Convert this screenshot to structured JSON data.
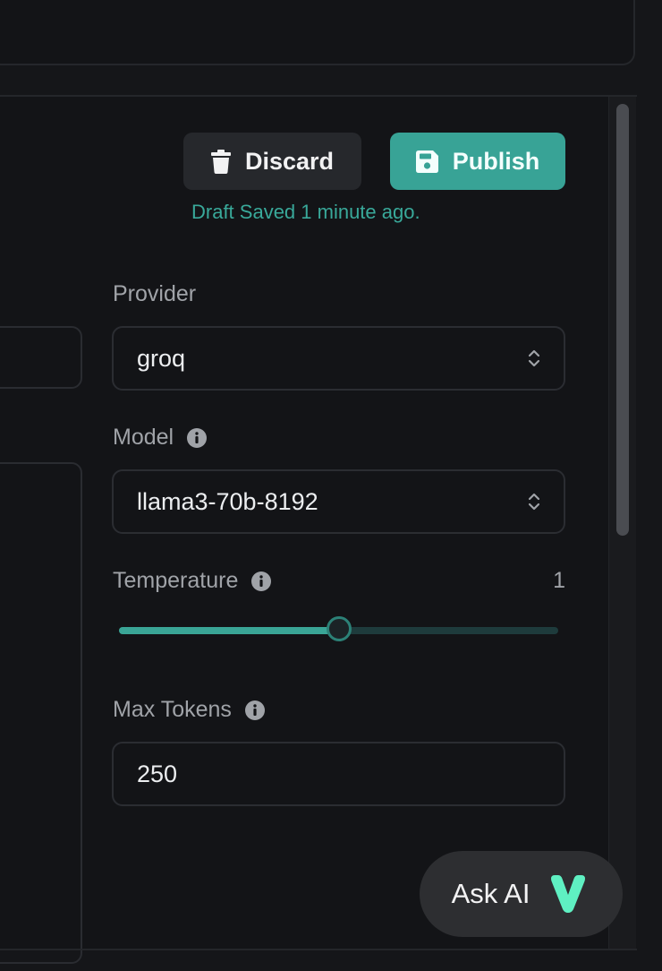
{
  "toolbar": {
    "discard_label": "Discard",
    "publish_label": "Publish",
    "draft_status": "Draft Saved 1 minute ago."
  },
  "provider": {
    "label": "Provider",
    "value": "groq"
  },
  "model": {
    "label": "Model",
    "value": "llama3-70b-8192"
  },
  "temperature": {
    "label": "Temperature",
    "value": "1",
    "fraction": 0.5
  },
  "max_tokens": {
    "label": "Max Tokens",
    "value": "250"
  },
  "assistant": {
    "label": "Ask AI"
  },
  "colors": {
    "accent": "#38a396",
    "status_text": "#39a99a",
    "background": "#131417"
  },
  "icons": {
    "discard": "trash-icon",
    "publish": "save-icon",
    "info": "info-icon",
    "select": "chevron-up-down-icon",
    "assistant": "v-logo-icon"
  }
}
